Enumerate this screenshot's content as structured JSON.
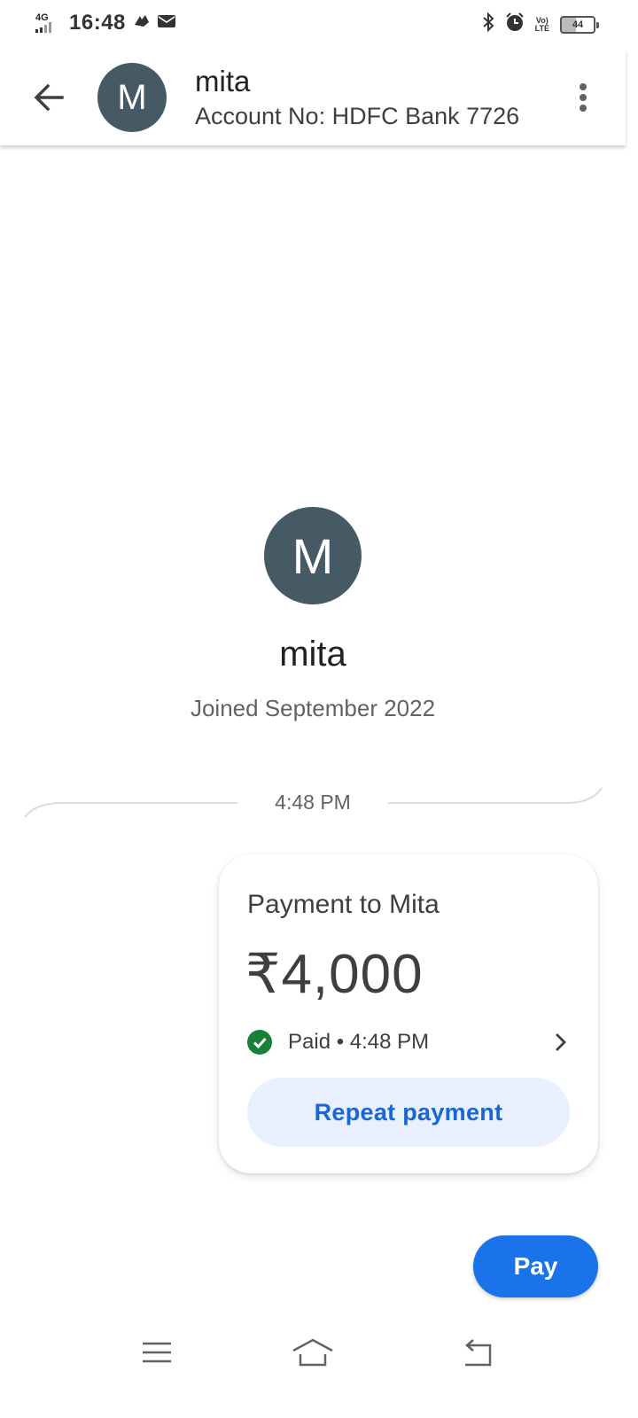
{
  "status_bar": {
    "network": "4G",
    "time": "16:48",
    "battery": "44"
  },
  "header": {
    "avatar_initial": "M",
    "name": "mita",
    "account": "Account No: HDFC Bank 7726"
  },
  "profile": {
    "avatar_initial": "M",
    "name": "mita",
    "joined": "Joined September 2022"
  },
  "conversation": {
    "timestamp": "4:48 PM"
  },
  "payment_card": {
    "title": "Payment to Mita",
    "amount": "₹4,000",
    "status": "Paid • 4:48 PM",
    "repeat_label": "Repeat payment"
  },
  "pay_button": {
    "label": "Pay"
  },
  "colors": {
    "avatar": "#455a64",
    "primary": "#1a73e8",
    "repeat_bg": "#e8f0fe",
    "repeat_text": "#1967d2",
    "success": "#188038"
  }
}
